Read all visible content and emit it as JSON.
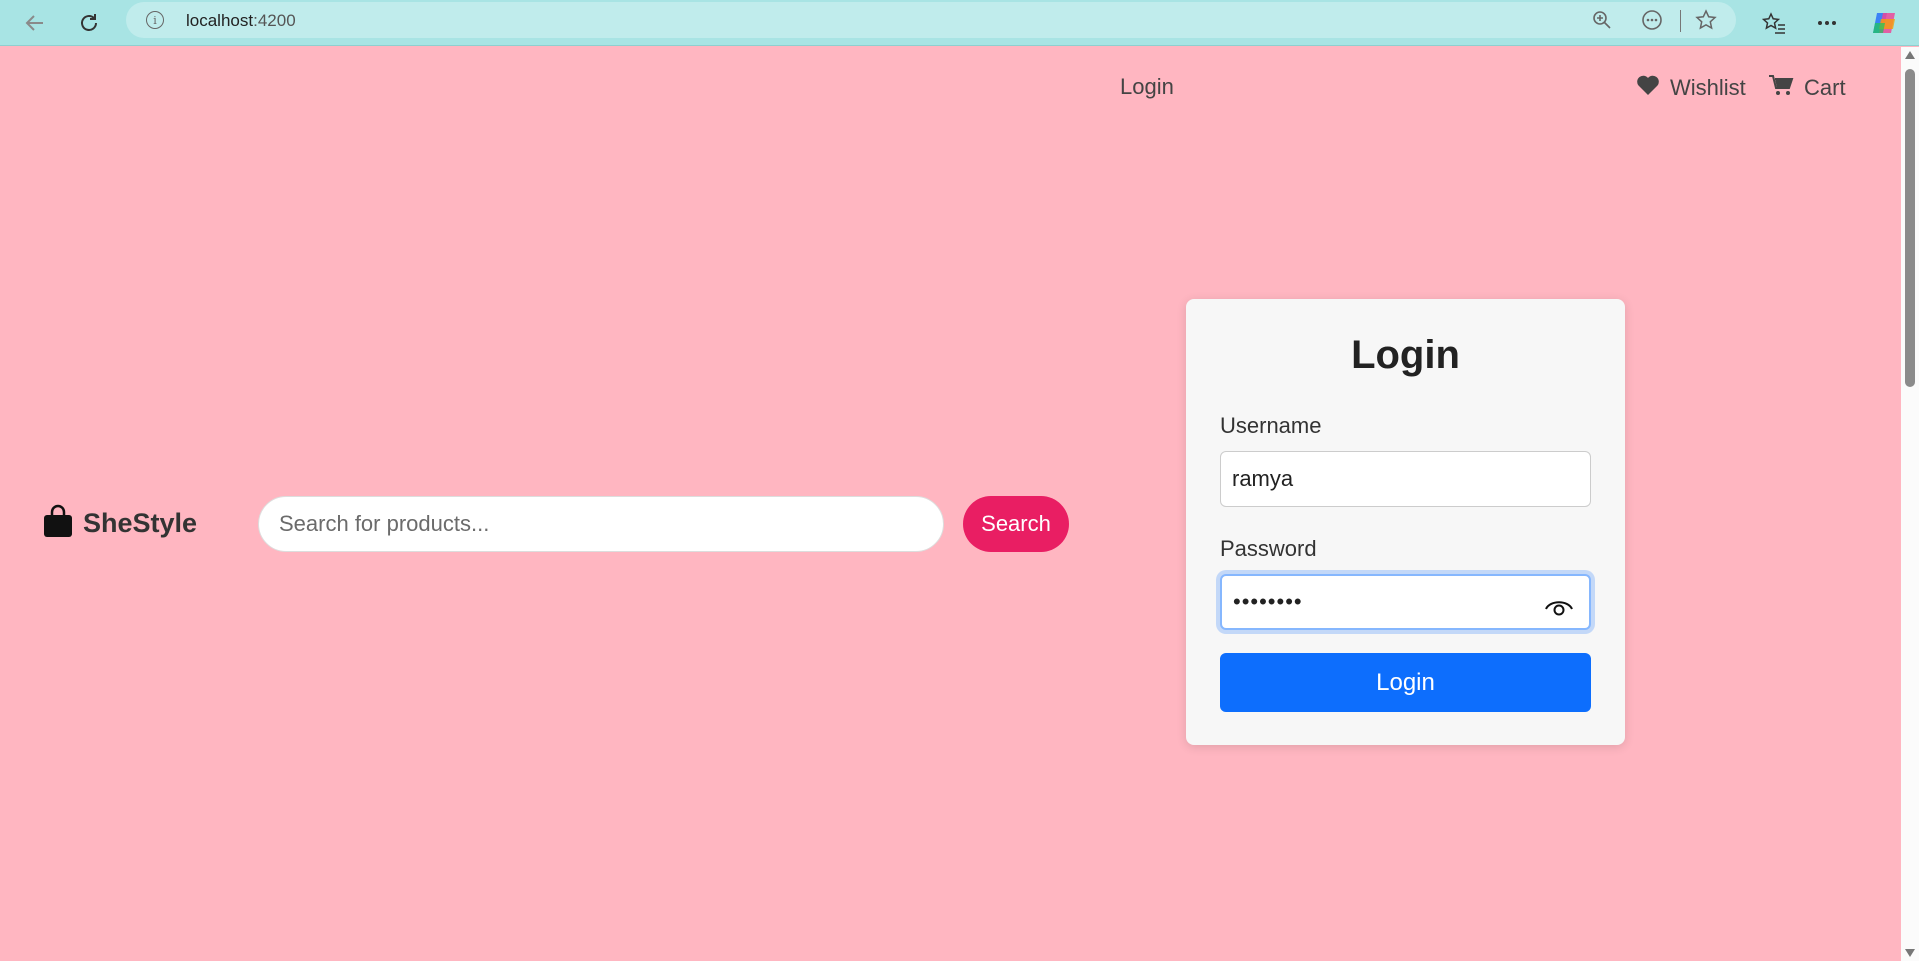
{
  "browser": {
    "url_host": "localhost",
    "url_port": ":4200",
    "icons": [
      "back-arrow-icon",
      "refresh-icon",
      "info-icon",
      "zoom-icon",
      "more-circle-icon",
      "star-icon",
      "favorites-icon",
      "menu-dots-icon",
      "copilot-icon"
    ]
  },
  "nav": {
    "login": "Login",
    "wishlist": "Wishlist",
    "cart": "Cart"
  },
  "brand": {
    "name": "SheStyle"
  },
  "search": {
    "placeholder": "Search for products...",
    "button": "Search"
  },
  "login_form": {
    "title": "Login",
    "username_label": "Username",
    "username_value": "ramya",
    "password_label": "Password",
    "password_value": "••••••••",
    "submit": "Login"
  },
  "colors": {
    "page_bg": "#ffb6c1",
    "search_button": "#e91e63",
    "login_button": "#0d6efd",
    "browser_bar": "#a8e4e4"
  }
}
